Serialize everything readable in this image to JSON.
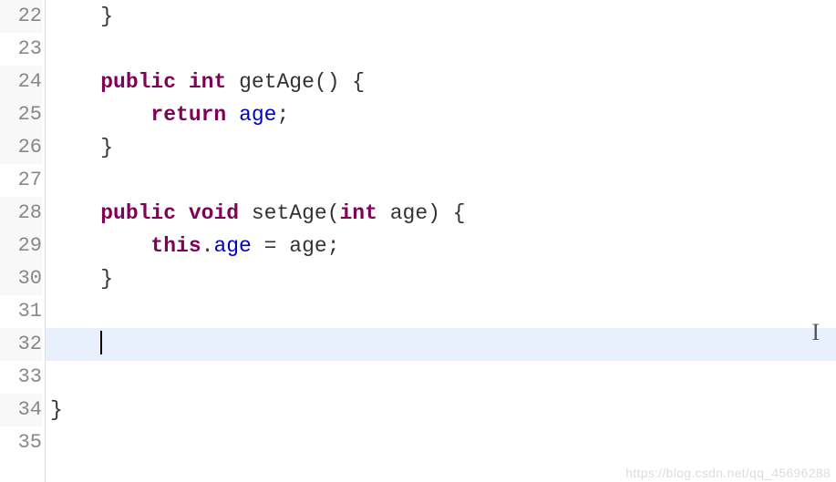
{
  "gutter": {
    "lines": [
      "22",
      "23",
      "24",
      "25",
      "26",
      "27",
      "28",
      "29",
      "30",
      "31",
      "32",
      "33",
      "34",
      "35"
    ]
  },
  "code": {
    "l22": "    }",
    "l24_pre": "    ",
    "l24_public": "public",
    "l24_sp1": " ",
    "l24_int": "int",
    "l24_rest": " getAge() {",
    "l25_pre": "        ",
    "l25_return": "return",
    "l25_sp": " ",
    "l25_age": "age",
    "l25_semi": ";",
    "l26": "    }",
    "l28_pre": "    ",
    "l28_public": "public",
    "l28_sp1": " ",
    "l28_void": "void",
    "l28_mid": " setAge(",
    "l28_int": "int",
    "l28_rest": " age) {",
    "l29_pre": "        ",
    "l29_this": "this",
    "l29_dot": ".",
    "l29_age1": "age",
    "l29_eq": " = age;",
    "l30": "    }",
    "l32_pre": "    ",
    "l34": "}"
  },
  "watermark": "https://blog.csdn.net/qq_45696288"
}
